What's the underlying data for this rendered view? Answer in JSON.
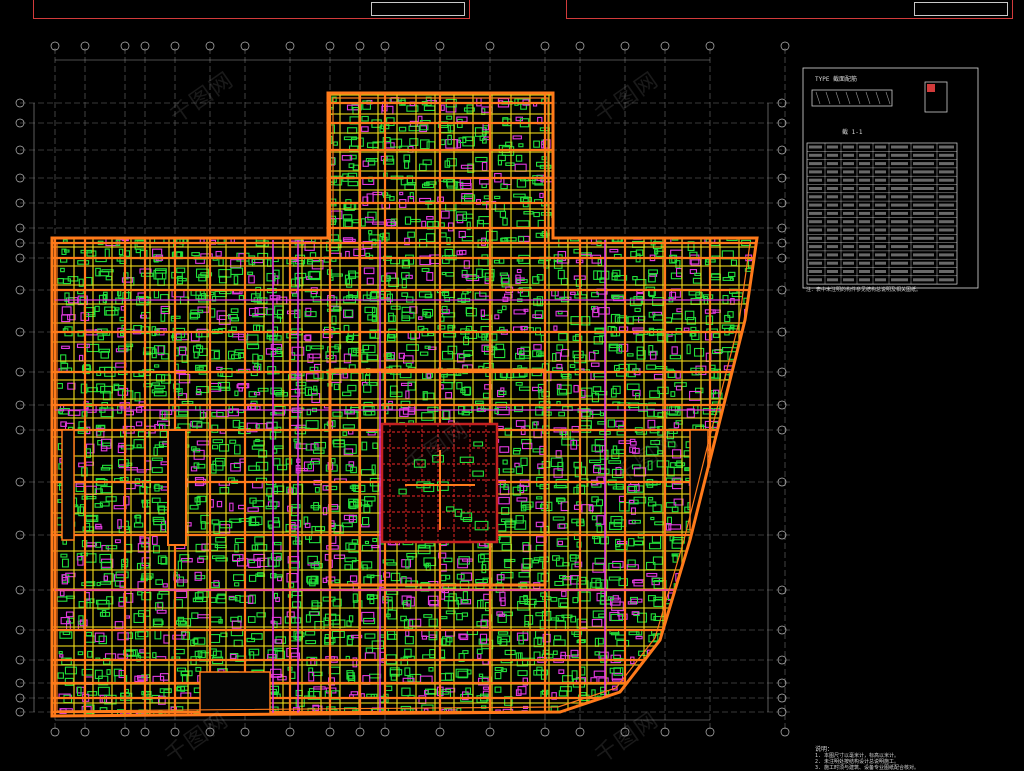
{
  "drawing": {
    "kind": "CAD structural floor framing plan",
    "colors": {
      "background": "#000000",
      "axis_line": "#6e6e6e",
      "boundary": "#ff7a1a",
      "beam": "#e8d21a",
      "rebar_green": "#22e03a",
      "rebar_magenta": "#e23ae0",
      "core": "#c42020",
      "frame": "#d23b3b",
      "table_line": "#dcdcdc"
    },
    "grid": {
      "vertical_count": 27,
      "horizontal_count": 22
    }
  },
  "side_panel": {
    "detail_title": "TYPE  截面配筋",
    "detail_label": "截 1-1",
    "table_rows": 17,
    "table_cols": 8,
    "note": "注：表中未注明的构件参见结构总说明及相关图纸。"
  },
  "bottom_notes": {
    "heading": "说明：",
    "lines": [
      "1. 本图尺寸以毫米计，标高以米计。",
      "2. 未注明处按结构设计总说明施工。",
      "3. 施工时须与建筑、设备专业图纸配合核对。"
    ]
  },
  "watermark": {
    "text": "千图网"
  }
}
